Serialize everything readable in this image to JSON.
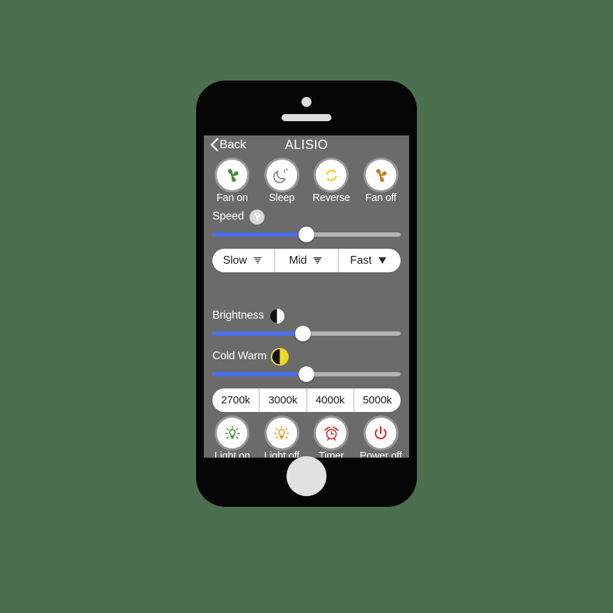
{
  "page": {
    "background_color": "#4a7050",
    "screen_background": "#6b6b6b",
    "accent_color": "#4a6fe8"
  },
  "navbar": {
    "back_label": "Back",
    "back_icon": "chevron-left-icon",
    "title": "ALISIO"
  },
  "fan_controls": [
    {
      "label": "Fan on",
      "icon": "fan-icon",
      "color": "#4a8a3a"
    },
    {
      "label": "Sleep",
      "icon": "moon-zzz-icon",
      "color": "#808080"
    },
    {
      "label": "Reverse",
      "icon": "reverse-arrows-icon",
      "color": "#f2c91e"
    },
    {
      "label": "Fan off",
      "icon": "fan-icon",
      "color": "#c08420"
    }
  ],
  "speed_slider": {
    "label": "Speed",
    "badge_icon": "fan-badge-icon",
    "value_percent": 50,
    "fill_color": "#4a6fe8",
    "track_color": "#b3b3b3"
  },
  "speed_presets": [
    {
      "label": "Slow",
      "icon": "wind-light-icon"
    },
    {
      "label": "Mid",
      "icon": "wind-medium-icon"
    },
    {
      "label": "Fast",
      "icon": "wind-strong-icon"
    }
  ],
  "brightness_slider": {
    "label": "Brightness",
    "badge_icon": "half-circle-white-icon",
    "value_percent": 48,
    "fill_color": "#4a6fe8",
    "track_color": "#b3b3b3"
  },
  "coldwarm_slider": {
    "label": "Cold Warm",
    "badge_icon": "half-circle-yellow-icon",
    "value_percent": 50,
    "fill_color": "#4a6fe8",
    "track_color": "#b3b3b3"
  },
  "temperature_presets": [
    {
      "label": "2700k"
    },
    {
      "label": "3000k"
    },
    {
      "label": "4000k"
    },
    {
      "label": "5000k"
    }
  ],
  "light_controls": [
    {
      "label": "Light on",
      "icon": "bulb-icon",
      "color": "#4a8a3a"
    },
    {
      "label": "Light off",
      "icon": "bulb-icon",
      "color": "#e09a20"
    },
    {
      "label": "Timer",
      "icon": "alarm-clock-icon",
      "color": "#d92020"
    },
    {
      "label": "Power off",
      "icon": "power-icon",
      "color": "#d92020"
    }
  ],
  "device": {
    "camera": "camera-dot",
    "speaker": "speaker-grill",
    "home_button": "home-button"
  }
}
